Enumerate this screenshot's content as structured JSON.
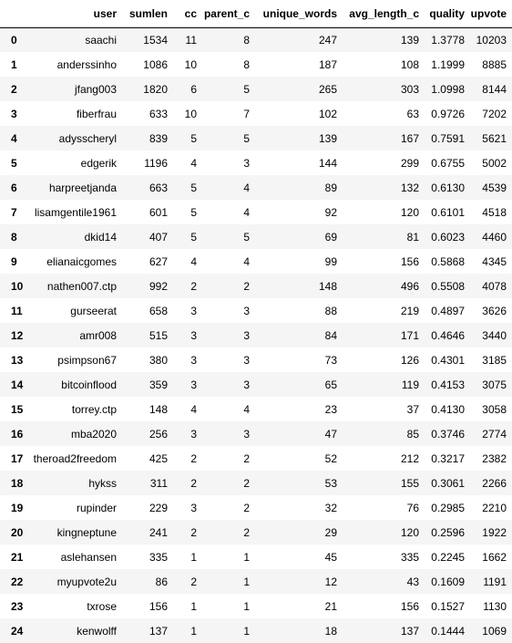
{
  "table": {
    "index_header": "",
    "columns": [
      "user",
      "sumlen",
      "cc",
      "parent_c",
      "unique_words",
      "avg_length_c",
      "quality",
      "upvote"
    ],
    "rows": [
      {
        "index": "0",
        "cells": [
          "saachi",
          "1534",
          "11",
          "8",
          "247",
          "139",
          "1.3778",
          "10203"
        ]
      },
      {
        "index": "1",
        "cells": [
          "anderssinho",
          "1086",
          "10",
          "8",
          "187",
          "108",
          "1.1999",
          "8885"
        ]
      },
      {
        "index": "2",
        "cells": [
          "jfang003",
          "1820",
          "6",
          "5",
          "265",
          "303",
          "1.0998",
          "8144"
        ]
      },
      {
        "index": "3",
        "cells": [
          "fiberfrau",
          "633",
          "10",
          "7",
          "102",
          "63",
          "0.9726",
          "7202"
        ]
      },
      {
        "index": "4",
        "cells": [
          "adysscheryl",
          "839",
          "5",
          "5",
          "139",
          "167",
          "0.7591",
          "5621"
        ]
      },
      {
        "index": "5",
        "cells": [
          "edgerik",
          "1196",
          "4",
          "3",
          "144",
          "299",
          "0.6755",
          "5002"
        ]
      },
      {
        "index": "6",
        "cells": [
          "harpreetjanda",
          "663",
          "5",
          "4",
          "89",
          "132",
          "0.6130",
          "4539"
        ]
      },
      {
        "index": "7",
        "cells": [
          "lisamgentile1961",
          "601",
          "5",
          "4",
          "92",
          "120",
          "0.6101",
          "4518"
        ]
      },
      {
        "index": "8",
        "cells": [
          "dkid14",
          "407",
          "5",
          "5",
          "69",
          "81",
          "0.6023",
          "4460"
        ]
      },
      {
        "index": "9",
        "cells": [
          "elianaicgomes",
          "627",
          "4",
          "4",
          "99",
          "156",
          "0.5868",
          "4345"
        ]
      },
      {
        "index": "10",
        "cells": [
          "nathen007.ctp",
          "992",
          "2",
          "2",
          "148",
          "496",
          "0.5508",
          "4078"
        ]
      },
      {
        "index": "11",
        "cells": [
          "gurseerat",
          "658",
          "3",
          "3",
          "88",
          "219",
          "0.4897",
          "3626"
        ]
      },
      {
        "index": "12",
        "cells": [
          "amr008",
          "515",
          "3",
          "3",
          "84",
          "171",
          "0.4646",
          "3440"
        ]
      },
      {
        "index": "13",
        "cells": [
          "psimpson67",
          "380",
          "3",
          "3",
          "73",
          "126",
          "0.4301",
          "3185"
        ]
      },
      {
        "index": "14",
        "cells": [
          "bitcoinflood",
          "359",
          "3",
          "3",
          "65",
          "119",
          "0.4153",
          "3075"
        ]
      },
      {
        "index": "15",
        "cells": [
          "torrey.ctp",
          "148",
          "4",
          "4",
          "23",
          "37",
          "0.4130",
          "3058"
        ]
      },
      {
        "index": "16",
        "cells": [
          "mba2020",
          "256",
          "3",
          "3",
          "47",
          "85",
          "0.3746",
          "2774"
        ]
      },
      {
        "index": "17",
        "cells": [
          "theroad2freedom",
          "425",
          "2",
          "2",
          "52",
          "212",
          "0.3217",
          "2382"
        ]
      },
      {
        "index": "18",
        "cells": [
          "hykss",
          "311",
          "2",
          "2",
          "53",
          "155",
          "0.3061",
          "2266"
        ]
      },
      {
        "index": "19",
        "cells": [
          "rupinder",
          "229",
          "3",
          "2",
          "32",
          "76",
          "0.2985",
          "2210"
        ]
      },
      {
        "index": "20",
        "cells": [
          "kingneptune",
          "241",
          "2",
          "2",
          "29",
          "120",
          "0.2596",
          "1922"
        ]
      },
      {
        "index": "21",
        "cells": [
          "aslehansen",
          "335",
          "1",
          "1",
          "45",
          "335",
          "0.2245",
          "1662"
        ]
      },
      {
        "index": "22",
        "cells": [
          "myupvote2u",
          "86",
          "2",
          "1",
          "12",
          "43",
          "0.1609",
          "1191"
        ]
      },
      {
        "index": "23",
        "cells": [
          "txrose",
          "156",
          "1",
          "1",
          "21",
          "156",
          "0.1527",
          "1130"
        ]
      },
      {
        "index": "24",
        "cells": [
          "kenwolff",
          "137",
          "1",
          "1",
          "18",
          "137",
          "0.1444",
          "1069"
        ]
      }
    ]
  }
}
